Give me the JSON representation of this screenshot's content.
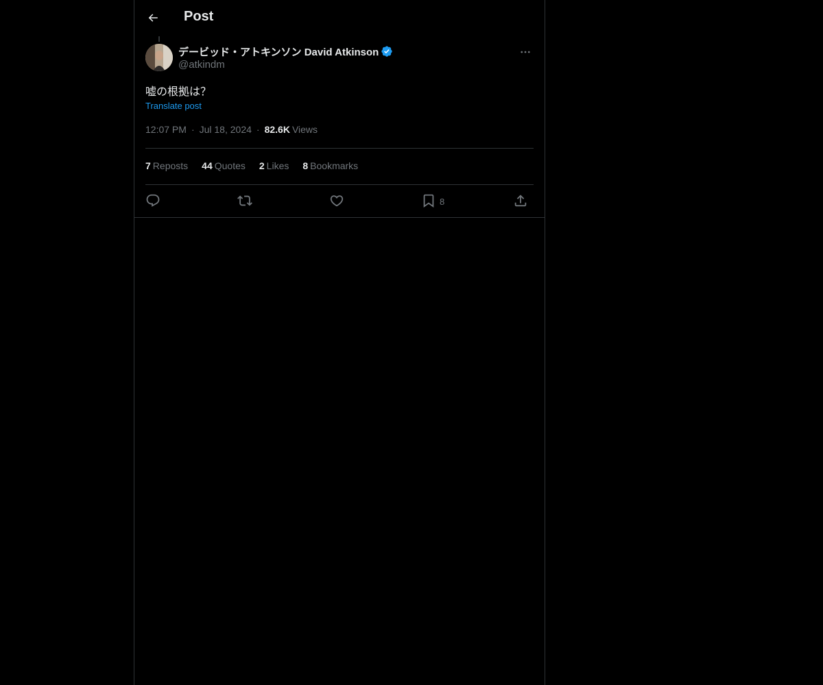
{
  "header": {
    "title": "Post",
    "back_icon": "arrow-left-icon"
  },
  "post": {
    "author": {
      "display_name": "デービッド・アトキンソン David Atkinson",
      "handle": "@atkindm",
      "verified": true,
      "verified_color": "#1d9bf0"
    },
    "text": "嘘の根拠は？",
    "translate_label": "Translate post",
    "time": "12:07 PM",
    "date": "Jul 18, 2024",
    "separator": "·",
    "views_count": "82.6K",
    "views_label": "Views"
  },
  "stats": {
    "reposts": {
      "count": "7",
      "label": "Reposts"
    },
    "quotes": {
      "count": "44",
      "label": "Quotes"
    },
    "likes": {
      "count": "2",
      "label": "Likes"
    },
    "bookmarks": {
      "count": "8",
      "label": "Bookmarks"
    }
  },
  "actions": {
    "reply_icon": "reply-icon",
    "repost_icon": "repost-icon",
    "like_icon": "heart-icon",
    "bookmark_icon": "bookmark-icon",
    "bookmark_count": "8",
    "share_icon": "share-icon"
  },
  "colors": {
    "background": "#000000",
    "text_primary": "#e7e9ea",
    "text_secondary": "#71767b",
    "accent": "#1d9bf0",
    "border": "#2f3336"
  }
}
